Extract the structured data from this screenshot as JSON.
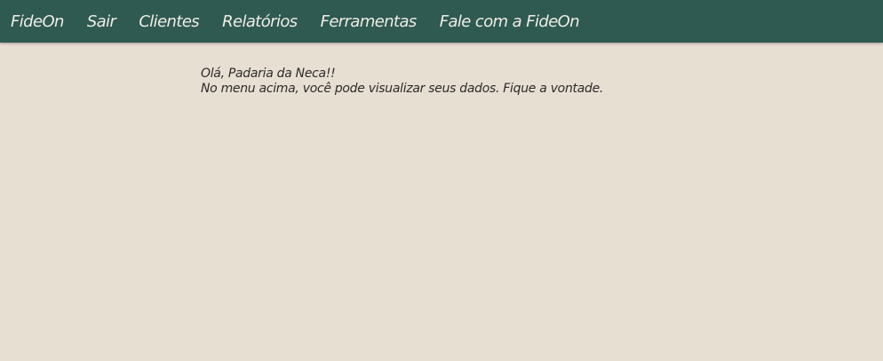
{
  "nav": {
    "brand": "FideOn",
    "items": [
      {
        "label": "Sair"
      },
      {
        "label": "Clientes"
      },
      {
        "label": "Relatórios"
      },
      {
        "label": "Ferramentas"
      },
      {
        "label": "Fale com a FideOn"
      }
    ]
  },
  "main": {
    "greeting": "Olá, Padaria da Neca!!",
    "message": "No menu acima, você pode visualizar seus dados. Fique a vontade."
  },
  "colors": {
    "navbar_bg": "#2e5a52",
    "page_bg": "#e8dfd3",
    "nav_text": "#f1ece4"
  }
}
